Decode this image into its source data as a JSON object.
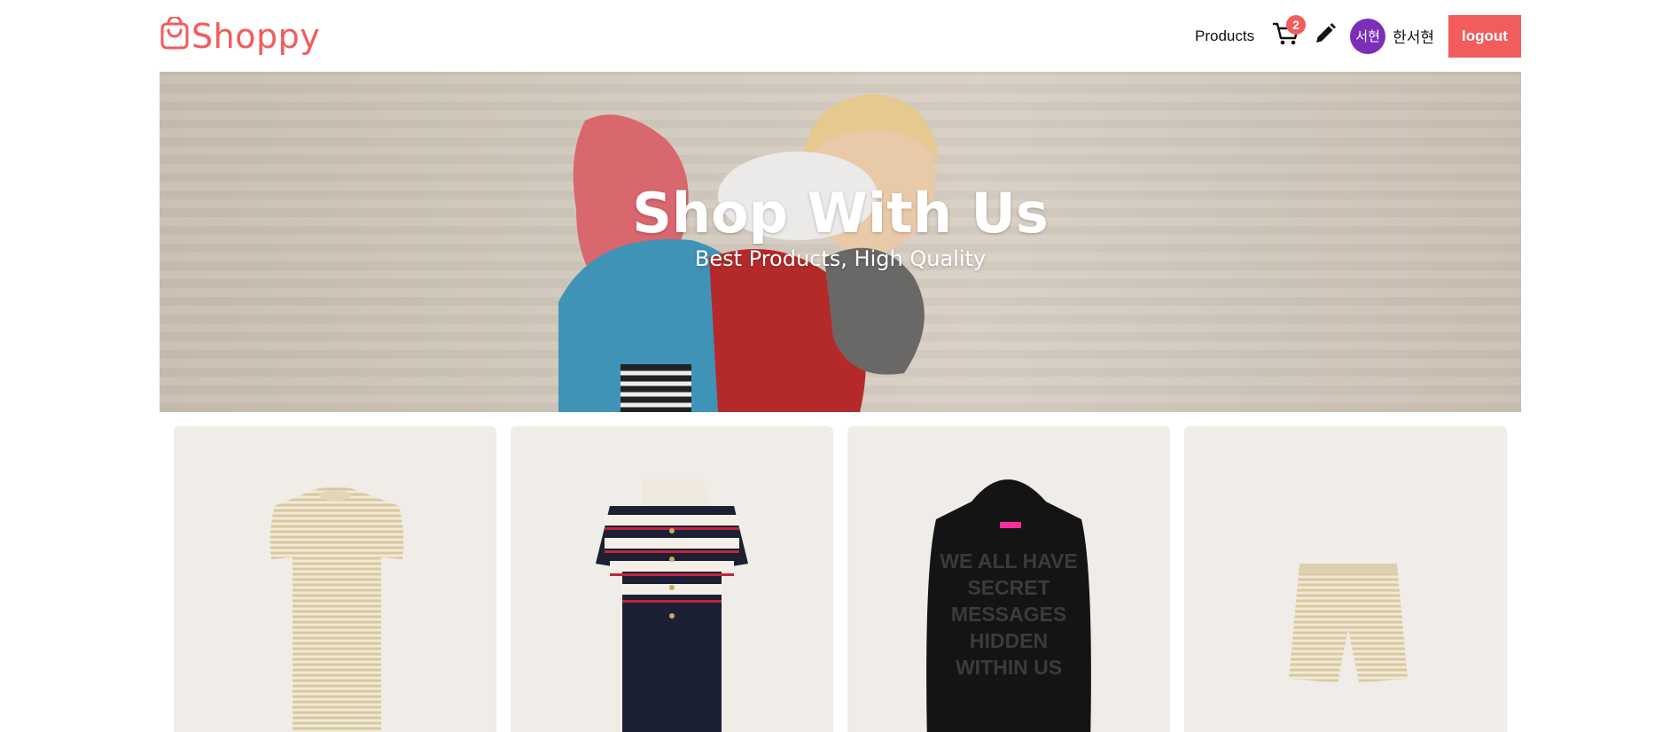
{
  "header": {
    "brand": "Shoppy",
    "nav_products": "Products",
    "cart_count": "2",
    "avatar_text": "서현",
    "username": "한서현",
    "logout_label": "logout"
  },
  "hero": {
    "title": "Shop With Us",
    "subtitle": "Best Products, High Quality"
  },
  "products": [
    {
      "image": "tweed-dress"
    },
    {
      "image": "striped-knit-dress"
    },
    {
      "image": "black-hoodie"
    },
    {
      "image": "tweed-shorts"
    }
  ],
  "hoodie_print": [
    "WE ALL HAVE",
    "SECRET",
    "MESSAGES",
    "HIDDEN",
    "WITHIN US"
  ],
  "colors": {
    "accent": "#f25c5c",
    "avatar": "#7b2fb8",
    "card_bg": "#f0ece8"
  }
}
